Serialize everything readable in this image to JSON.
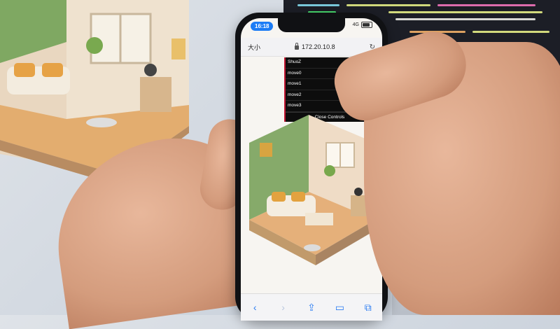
{
  "browser": {
    "status_time": "16:18",
    "signal": "4G",
    "text_size_button": "大小",
    "url": "172.20.10.8"
  },
  "controls_panel": {
    "items": [
      "ShuoZ",
      "move0",
      "move1",
      "move2",
      "move3"
    ],
    "close_label": "Close Controls"
  },
  "toolbar": {
    "icons": [
      "back-icon",
      "forward-icon",
      "share-icon",
      "bookmarks-icon",
      "tabs-icon"
    ]
  },
  "colors": {
    "status_pill": "#1c7cf5",
    "controls_bg": "#0d0d0d",
    "controls_accent": "#c01530",
    "toolbar_icon": "#2a7cf2"
  }
}
